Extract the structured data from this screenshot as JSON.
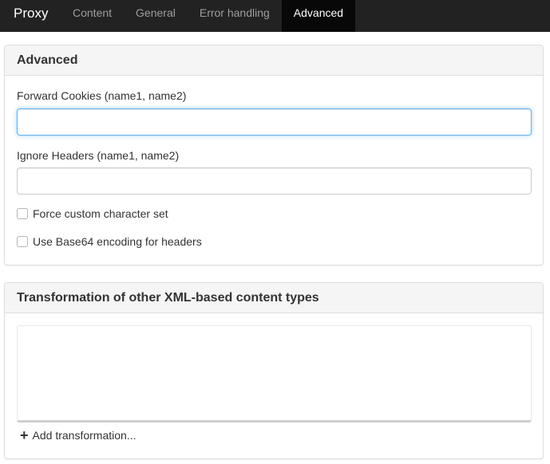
{
  "navbar": {
    "brand": "Proxy",
    "tabs": [
      {
        "label": "Content",
        "active": false
      },
      {
        "label": "General",
        "active": false
      },
      {
        "label": "Error handling",
        "active": false
      },
      {
        "label": "Advanced",
        "active": true
      }
    ]
  },
  "advanced": {
    "title": "Advanced",
    "forward_cookies": {
      "label": "Forward Cookies (name1, name2)",
      "value": ""
    },
    "ignore_headers": {
      "label": "Ignore Headers (name1, name2)",
      "value": ""
    },
    "force_charset": {
      "label": "Force custom character set",
      "checked": false
    },
    "base64_headers": {
      "label": "Use Base64 encoding for headers",
      "checked": false
    }
  },
  "transformation": {
    "title": "Transformation of other XML-based content types",
    "add_label": "Add transformation...",
    "add_icon": "plus-icon"
  },
  "colors": {
    "navbar_bg": "#222222",
    "active_tab_bg": "#080808",
    "focus_border": "#66afe9"
  }
}
